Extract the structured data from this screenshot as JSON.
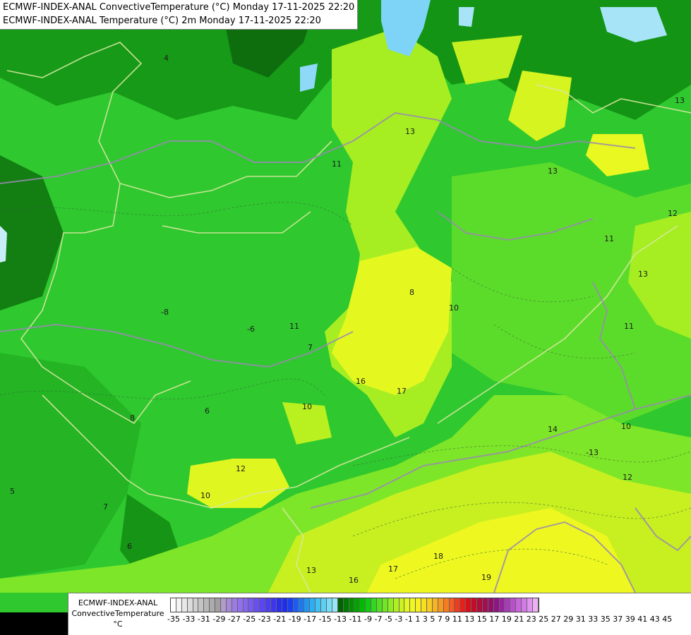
{
  "titles": {
    "line1": "ECMWF-INDEX-ANAL ConvectiveTemperature (°C) Monday 17-11-2025 22:20",
    "line2": "ECMWF-INDEX-ANAL Temperature (°C) 2m Monday 17-11-2025 22:20"
  },
  "legend": {
    "model": "ECMWF-INDEX-ANAL",
    "variable": "ConvectiveTemperature",
    "unit": "°C",
    "ticks": "-35 -33 -31 -29 -27 -25 -23 -21 -19 -17 -15 -13 -11  -9  -7  -5  -3  -1   1   3   5   7   9  11  13  15  17  19  21  23  25  27  29  31  33  35  37  39  41  43  45",
    "colors": [
      "#ffffff",
      "#f4f4f4",
      "#e8e8e8",
      "#dcdcdc",
      "#d0d0d0",
      "#c4c4c4",
      "#b8b8b8",
      "#acacac",
      "#a0a0a0",
      "#b09cc8",
      "#a68ad8",
      "#9c7ae4",
      "#9270ee",
      "#8466f0",
      "#765af2",
      "#684ef4",
      "#5a46f2",
      "#4c3ef0",
      "#3e36ee",
      "#2a2ef0",
      "#1c2ef2",
      "#1a3ef4",
      "#1a5cf6",
      "#1a7af4",
      "#2096f2",
      "#2eaef2",
      "#40c2f2",
      "#5ad0f4",
      "#78dcf6",
      "#96e6f8",
      "#006400",
      "#007a00",
      "#009000",
      "#00a600",
      "#00bc00",
      "#10cc10",
      "#30d820",
      "#50e020",
      "#70e820",
      "#90ee20",
      "#b0f020",
      "#ccf420",
      "#e4f820",
      "#f0f820",
      "#f8f020",
      "#f8e020",
      "#f8cc20",
      "#f8b420",
      "#f89a20",
      "#f87c20",
      "#f85c20",
      "#f03c1c",
      "#e8201c",
      "#d8101c",
      "#c40c28",
      "#b00c3c",
      "#a01050",
      "#941068",
      "#901484",
      "#9a24a0",
      "#a83cb8",
      "#b850cc",
      "#c864dc",
      "#d47ae8",
      "#e094f0",
      "#ecb0f4"
    ]
  },
  "contour_labels": [
    "-6",
    "-8",
    "8",
    "7",
    "6",
    "5",
    "4",
    "10",
    "10",
    "10",
    "11",
    "11",
    "11",
    "12",
    "12",
    "12",
    "13",
    "13",
    "13",
    "13",
    "14",
    "16",
    "16",
    "17",
    "17",
    "18",
    "19",
    "13",
    "10",
    "8",
    "-13",
    "11",
    "6",
    "7"
  ]
}
